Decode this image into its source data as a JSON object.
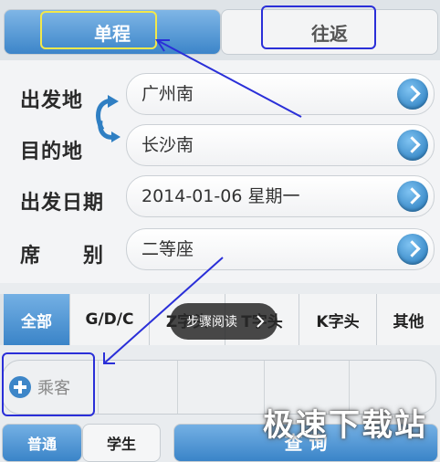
{
  "tabs": {
    "single": "单程",
    "return": "往返"
  },
  "form": {
    "from_label": "出发地",
    "to_label": "目的地",
    "date_label": "出发日期",
    "seat_label": "席　　别",
    "from_value": "广州南",
    "to_value": "长沙南",
    "date_value": "2014-01-06 星期一",
    "seat_value": "二等座"
  },
  "filters": [
    "全部",
    "G/D/C",
    "Z字头",
    "T字头",
    "K字头",
    "其他"
  ],
  "passengers": {
    "add_label": "乘客"
  },
  "bottom": {
    "normal": "普通",
    "student": "学生",
    "search": "查 询"
  },
  "tooltip": {
    "text": "步骤阅读"
  },
  "watermark": {
    "text": "极速下载站"
  },
  "colors": {
    "accent": "#3c85c9",
    "annotation": "#2a2fd8",
    "highlight": "#f3e84a"
  }
}
